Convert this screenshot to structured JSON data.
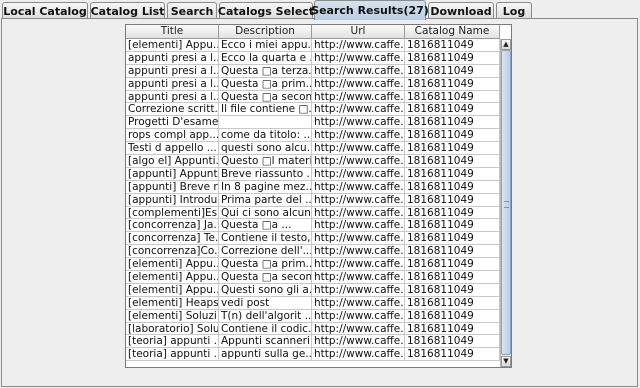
{
  "tabs": [
    {
      "label": "Local Catalog",
      "active": false
    },
    {
      "label": "Catalog List",
      "active": false
    },
    {
      "label": "Search",
      "active": false
    },
    {
      "label": "Catalogs Select",
      "active": false
    },
    {
      "label": "Search Results(27)",
      "active": true
    },
    {
      "label": "Download",
      "active": false
    },
    {
      "label": "Log",
      "active": false
    }
  ],
  "table": {
    "columns": [
      "Title",
      "Description",
      "Url",
      "Catalog Name"
    ],
    "rows": [
      [
        "[elementi] Appu...",
        "Ecco i miei appu...",
        "http://www.caffe...",
        "1816811049"
      ],
      [
        "appunti presi a l...",
        "Ecco la quarta e ...",
        "http://www.caffe...",
        "1816811049"
      ],
      [
        "appunti presi a l...",
        "Questa □a terza...",
        "http://www.caffe...",
        "1816811049"
      ],
      [
        "appunti presi a l...",
        "Questa □a prim...",
        "http://www.caffe...",
        "1816811049"
      ],
      [
        "appunti presi a l...",
        "Questa □a secon...",
        "http://www.caffe...",
        "1816811049"
      ],
      [
        "Correzione scritt...",
        "Il file contiene □...",
        "http://www.caffe...",
        "1816811049"
      ],
      [
        "Progetti D'esame...",
        "",
        "http://www.caffe...",
        "1816811049"
      ],
      [
        "rops compl app...",
        "come da titolo: ...",
        "http://www.caffe...",
        "1816811049"
      ],
      [
        "Testi d appello ...",
        "questi sono alcu...",
        "http://www.caffe...",
        "1816811049"
      ],
      [
        "[algo el] Appunti...",
        "Questo □l materi...",
        "http://www.caffe...",
        "1816811049"
      ],
      [
        "[appunti] Appunt...",
        "Breve riassunto ...",
        "http://www.caffe...",
        "1816811049"
      ],
      [
        "[appunti] Breve r...",
        "In 8 pagine mez...",
        "http://www.caffe...",
        "1816811049"
      ],
      [
        "[appunti] Introdu...",
        "Prima parte del ...",
        "http://www.caffe...",
        "1816811049"
      ],
      [
        "[complementi]Es...",
        "Qui ci sono alcun...",
        "http://www.caffe...",
        "1816811049"
      ],
      [
        "[concorrenza] Ja...",
        "Questa □a ...",
        "http://www.caffe...",
        "1816811049"
      ],
      [
        "[concorrenza] Te...",
        "Contiene il testo,...",
        "http://www.caffe...",
        "1816811049"
      ],
      [
        "[concorrenza]Co...",
        "Correzione dell'...",
        "http://www.caffe...",
        "1816811049"
      ],
      [
        "[elementi] Appu...",
        "Questa □a prim...",
        "http://www.caffe...",
        "1816811049"
      ],
      [
        "[elementi] Appu...",
        "Questa □a secon...",
        "http://www.caffe...",
        "1816811049"
      ],
      [
        "[elementi] Appu...",
        "Questi sono gli a...",
        "http://www.caffe...",
        "1816811049"
      ],
      [
        "[elementi] Heaps...",
        "vedi post",
        "http://www.caffe...",
        "1816811049"
      ],
      [
        "[elementi] Soluzi...",
        "T(n) dell'algorit ...",
        "http://www.caffe...",
        "1816811049"
      ],
      [
        "[laboratorio] Solu...",
        "Contiene il codic...",
        "http://www.caffe...",
        "1816811049"
      ],
      [
        "[teoria] appunti ...",
        "Appunti scanneri...",
        "http://www.caffe...",
        "1816811049"
      ],
      [
        "[teoria] appunti ...",
        "appunti sulla ge...",
        "http://www.caffe...",
        "1816811049"
      ]
    ]
  },
  "scrollbar": {
    "up_icon": "arrow-up-icon",
    "down_icon": "arrow-down-icon"
  }
}
